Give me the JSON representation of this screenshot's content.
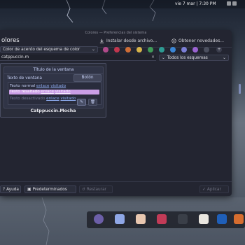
{
  "topbar": {
    "clock": "vie 7 mar | 7:30 PM"
  },
  "window": {
    "title": "Colores — Preferencias del sistema",
    "app_title": "olores",
    "install_label": "Instalar desde archivo...",
    "get_new_label": "Obtener novedades..."
  },
  "accent": {
    "combo_label": "Color de acento del esquema de color",
    "swatches": [
      "#b04a8a",
      "#c0364e",
      "#cf6d36",
      "#d6b44a",
      "#3f9b57",
      "#2d9b93",
      "#3a86d6",
      "#7b7fd6",
      "#9a63d1",
      "#4b4f5e"
    ],
    "add_label": "+"
  },
  "search": {
    "value": "catppuccin.m",
    "clear_icon": "×"
  },
  "filter": {
    "label": "Todos los esquemas"
  },
  "theme": {
    "name": "Catppuccin.Mocha",
    "preview": {
      "title": "Título de la ventana",
      "text_label": "Texto de ventana",
      "button_label": "Botón",
      "normal_text": "Texto normal",
      "selected_text": "Texto resaltado",
      "disabled_text": "Texto desactivado",
      "link": "enlace",
      "visited": "visitado"
    }
  },
  "footer": {
    "help": "Ayuda",
    "defaults": "Predeterminados",
    "restore": "Restaurar",
    "apply": "Aplicar"
  }
}
